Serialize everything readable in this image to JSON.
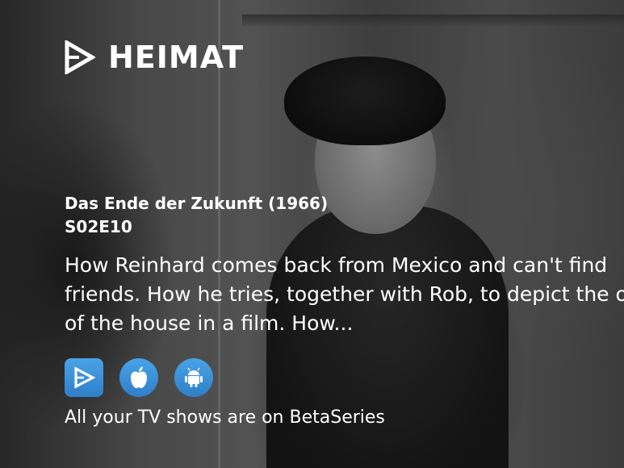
{
  "brand": {
    "title": "HEIMAT",
    "logo_icon": "betaseries-play-icon"
  },
  "episode": {
    "title": "Das Ende der Zukunft (1966)",
    "code": "S02E10",
    "description_lines": [
      "How Reinhard comes back from Mexico and can't find",
      "friends. How he tries, together with Rob, to depict the o",
      "of the house in a film. How..."
    ]
  },
  "stores": [
    {
      "name": "BetaSeries",
      "icon": "betaseries-app-icon"
    },
    {
      "name": "Apple",
      "icon": "apple-icon"
    },
    {
      "name": "Android",
      "icon": "android-icon"
    }
  ],
  "tagline": "All your TV shows are on BetaSeries",
  "colors": {
    "accent": "#3b8fd8",
    "text": "#ffffff"
  }
}
